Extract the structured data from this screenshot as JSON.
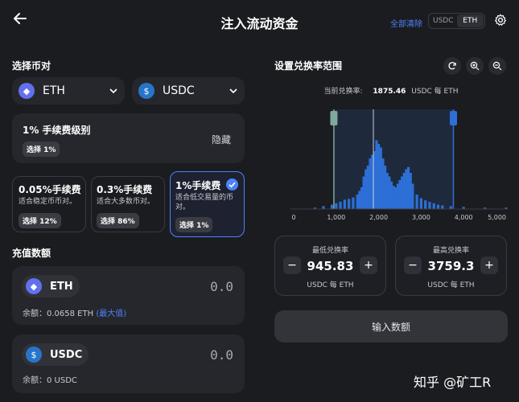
{
  "header": {
    "title": "注入流动资金",
    "clear_all": "全部清除",
    "toggle": [
      "USDC",
      "ETH"
    ]
  },
  "pair": {
    "section_title": "选择币对",
    "token_a": "ETH",
    "token_b": "USDC"
  },
  "fee_tier": {
    "title": "1% 手续费级别",
    "selected_badge": "选择 1%",
    "hide_label": "隐藏",
    "options": [
      {
        "title": "0.05%手续费",
        "desc": "适合稳定币币对。",
        "badge": "选择 12%",
        "selected": false
      },
      {
        "title": "0.3%手续费",
        "desc": "适合大多数币对。",
        "badge": "选择 86%",
        "selected": false
      },
      {
        "title": "1%手续费",
        "desc": "适合低交易量的币对。",
        "badge": "选择 1%",
        "selected": true
      }
    ]
  },
  "deposit": {
    "section_title": "充值数额",
    "eth": {
      "symbol": "ETH",
      "amount": "0.0",
      "balance": "余额：0.0658 ETH",
      "max": "(最大值)"
    },
    "usdc": {
      "symbol": "USDC",
      "amount": "0.0",
      "balance": "余额：0 USDC"
    }
  },
  "price_range": {
    "section_title": "设置兑换率范围",
    "current_label": "当前兑换率:",
    "current_value": "1875.46",
    "current_unit": "USDC 每 ETH",
    "min_label": "最低兑换率",
    "min_value": "945.83",
    "min_unit": "USDC 每 ETH",
    "max_label": "最高兑换率",
    "max_value": "3759.3",
    "max_unit": "USDC 每 ETH",
    "submit": "输入数额"
  },
  "chart_data": {
    "type": "bar",
    "x_ticks": [
      "0",
      "1,000",
      "2,000",
      "3,000",
      "4,000",
      "5,000"
    ],
    "xlim": [
      0,
      5000
    ],
    "current_price": 1875.46,
    "range_min": 945.83,
    "range_max": 3759.3,
    "bar_color": "#2d6fd6",
    "bars": [
      [
        500,
        0.02
      ],
      [
        700,
        0.04
      ],
      [
        900,
        0.06
      ],
      [
        1000,
        0.08
      ],
      [
        1100,
        0.1
      ],
      [
        1200,
        0.13
      ],
      [
        1300,
        0.14
      ],
      [
        1400,
        0.16
      ],
      [
        1500,
        0.2
      ],
      [
        1550,
        0.25
      ],
      [
        1600,
        0.3
      ],
      [
        1650,
        0.45
      ],
      [
        1700,
        0.55
      ],
      [
        1750,
        0.6
      ],
      [
        1800,
        0.7
      ],
      [
        1850,
        0.75
      ],
      [
        1900,
        0.8
      ],
      [
        1950,
        0.95
      ],
      [
        2000,
        0.9
      ],
      [
        2050,
        0.85
      ],
      [
        2100,
        0.7
      ],
      [
        2150,
        0.6
      ],
      [
        2200,
        0.5
      ],
      [
        2250,
        0.45
      ],
      [
        2300,
        0.38
      ],
      [
        2350,
        0.32
      ],
      [
        2400,
        0.3
      ],
      [
        2450,
        0.35
      ],
      [
        2500,
        0.4
      ],
      [
        2550,
        0.45
      ],
      [
        2600,
        0.5
      ],
      [
        2650,
        0.55
      ],
      [
        2700,
        0.58
      ],
      [
        2750,
        0.5
      ],
      [
        2800,
        0.35
      ],
      [
        2900,
        0.2
      ],
      [
        3000,
        0.15
      ],
      [
        3100,
        0.12
      ],
      [
        3200,
        0.1
      ],
      [
        3300,
        0.08
      ],
      [
        3400,
        0.06
      ],
      [
        3500,
        0.05
      ],
      [
        3700,
        0.04
      ],
      [
        4000,
        0.03
      ],
      [
        4500,
        0.02
      ],
      [
        5000,
        0.02
      ]
    ]
  },
  "watermark": "知乎 @矿工R"
}
